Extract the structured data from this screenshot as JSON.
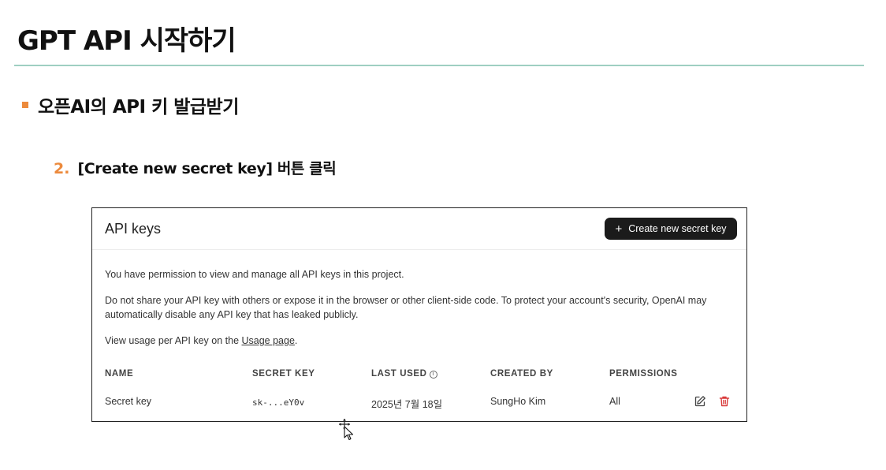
{
  "slide": {
    "title": "GPT API 시작하기",
    "bullet": "오픈AI의 API 키 발급받기",
    "step_number": "2.",
    "step_text": "[Create new secret key] 버튼 클릭"
  },
  "panel": {
    "title": "API keys",
    "create_button_label": "Create new secret key",
    "paragraph1": "You have permission to view and manage all API keys in this project.",
    "paragraph2": "Do not share your API key with others or expose it in the browser or other client-side code. To protect your account's security, OpenAI may automatically disable any API key that has leaked publicly.",
    "paragraph3_prefix": "View usage per API key on the ",
    "paragraph3_link": "Usage page",
    "paragraph3_suffix": ".",
    "columns": [
      "NAME",
      "SECRET KEY",
      "LAST USED",
      "CREATED BY",
      "PERMISSIONS"
    ],
    "rows": [
      {
        "name": "Secret key",
        "secret_key": "sk-...eY0v",
        "last_used": "2025년 7월 18일",
        "created_by": "SungHo Kim",
        "permissions": "All"
      }
    ]
  },
  "colors": {
    "accent_orange": "#ec8a3c",
    "rule_teal": "#9fcfc2",
    "button_dark": "#1b1b1b",
    "delete_red": "#d93a3a"
  },
  "icons": [
    "plus-icon",
    "info-icon",
    "edit-icon",
    "trash-icon",
    "move-cursor-icon"
  ]
}
